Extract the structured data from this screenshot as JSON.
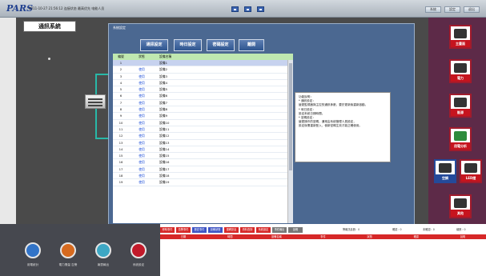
{
  "topbar": {
    "logo": "PARS",
    "system_info": "2011-10-27 21:56:12  连接状态  最高优先  电能人员",
    "nav": [
      "prev",
      "home",
      "next"
    ],
    "window_buttons": [
      "系統",
      "設定",
      "退出"
    ]
  },
  "main": {
    "system_title": "通訊系統",
    "dialog_title": "系統設定",
    "toolbar": [
      "通訊設定",
      "時日設定",
      "密碼設定",
      "離開"
    ],
    "table": {
      "headers": [
        "編號",
        "狀態",
        "設備名稱"
      ],
      "rows": [
        [
          "1",
          "",
          "設備1"
        ],
        [
          "2",
          "使用",
          "設備2"
        ],
        [
          "3",
          "使用",
          "設備3"
        ],
        [
          "4",
          "使用",
          "設備4"
        ],
        [
          "5",
          "使用",
          "設備5"
        ],
        [
          "6",
          "使用",
          "設備6"
        ],
        [
          "7",
          "使用",
          "設備7"
        ],
        [
          "8",
          "使用",
          "設備8"
        ],
        [
          "9",
          "使用",
          "設備9"
        ],
        [
          "10",
          "使用",
          "設備10"
        ],
        [
          "11",
          "使用",
          "設備11"
        ],
        [
          "12",
          "使用",
          "設備12"
        ],
        [
          "13",
          "使用",
          "設備13"
        ],
        [
          "14",
          "使用",
          "設備14"
        ],
        [
          "15",
          "使用",
          "設備15"
        ],
        [
          "16",
          "使用",
          "設備16"
        ],
        [
          "17",
          "使用",
          "設備17"
        ],
        [
          "18",
          "使用",
          "設備18"
        ],
        [
          "19",
          "使用",
          "設備19"
        ]
      ]
    },
    "notes": [
      "功能說明：",
      "* 通訊設定：",
      "  變更監視器與主控的通訊參數，要於更新後重新啟動。",
      "* 時日設定：",
      "  設定系統日期時間。",
      "* 密碼設定：",
      "  變更操作的密碼，通常由系統管理人員設定，",
      "  設定後需重新登入，使新密碼生效才能正確使用。"
    ]
  },
  "right": {
    "icons": [
      {
        "name": "主畫面",
        "icon": "monitor-icon",
        "style": "red"
      },
      {
        "name": "電力",
        "icon": "plug-icon",
        "style": "red"
      },
      {
        "name": "能源",
        "icon": "energy-icon",
        "style": "red"
      },
      {
        "name": "用電分析",
        "icon": "chart-icon",
        "style": "red"
      },
      {
        "name": "空調",
        "icon": "fan-icon",
        "style": "blue"
      },
      {
        "name": "LED燈",
        "icon": "bulb-icon",
        "style": "red"
      },
      {
        "name": "其他",
        "icon": "disk-icon",
        "style": "red"
      }
    ]
  },
  "bottom_left": {
    "items": [
      {
        "label": "用電統計",
        "icon": "analytics-icon"
      },
      {
        "label": "電力需量\n告警",
        "icon": "alarm-icon"
      },
      {
        "label": "報表輸出",
        "icon": "report-icon"
      },
      {
        "label": "系統設定",
        "icon": "settings-icon"
      }
    ]
  },
  "bottom_right": {
    "tabs": [
      "即時事件",
      "告警事件",
      "歷史事件",
      "設備狀態",
      "運轉訊息",
      "資料查詢",
      "系統設定",
      "事件輸出",
      "說明"
    ],
    "headers": [
      "日期",
      "時間",
      "設備名稱",
      "事件",
      "狀態",
      "確認",
      "說明"
    ],
    "status_items": [
      "警報訊息數：0",
      "確認：0",
      "未確認：0",
      "總數：0"
    ]
  }
}
